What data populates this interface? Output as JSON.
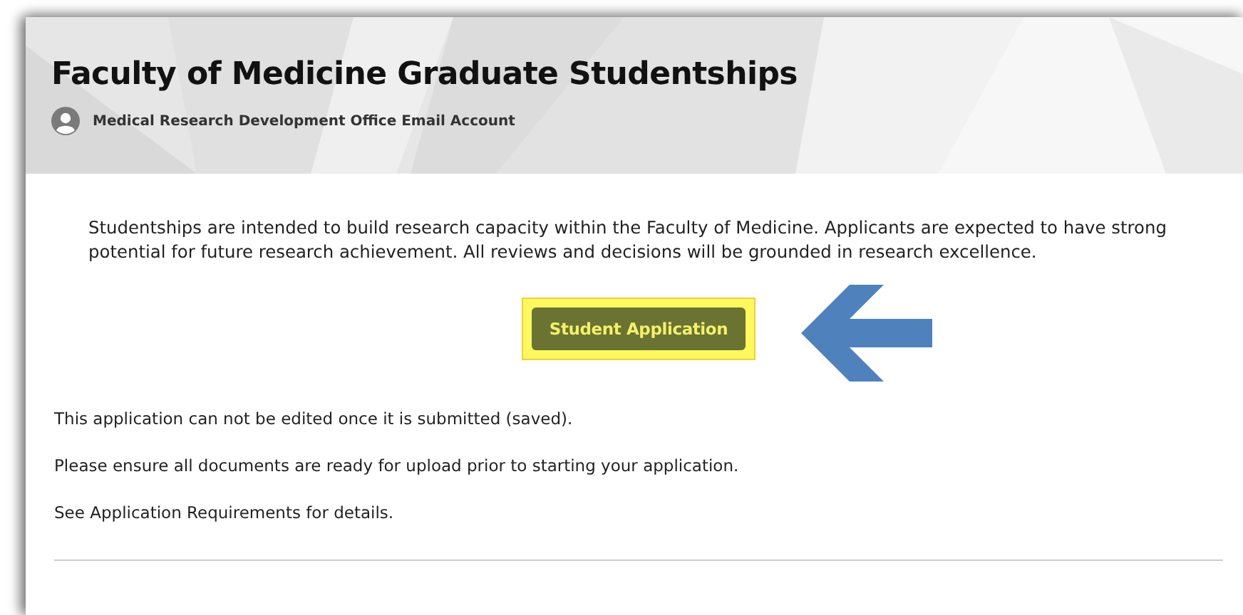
{
  "header": {
    "title": "Faculty of Medicine Graduate Studentships",
    "account": "Medical Research Development Office Email Account"
  },
  "intro": "Studentships are intended to build research capacity within the Faculty of Medicine. Applicants are expected to have strong potential for future research achievement. All reviews and decisions will be grounded in research excellence.",
  "button": {
    "label": "Student Application"
  },
  "notes": [
    "This application can not be edited once it is submitted (saved).",
    "Please ensure all documents are ready for upload prior to starting your application.",
    "See Application Requirements for details."
  ]
}
